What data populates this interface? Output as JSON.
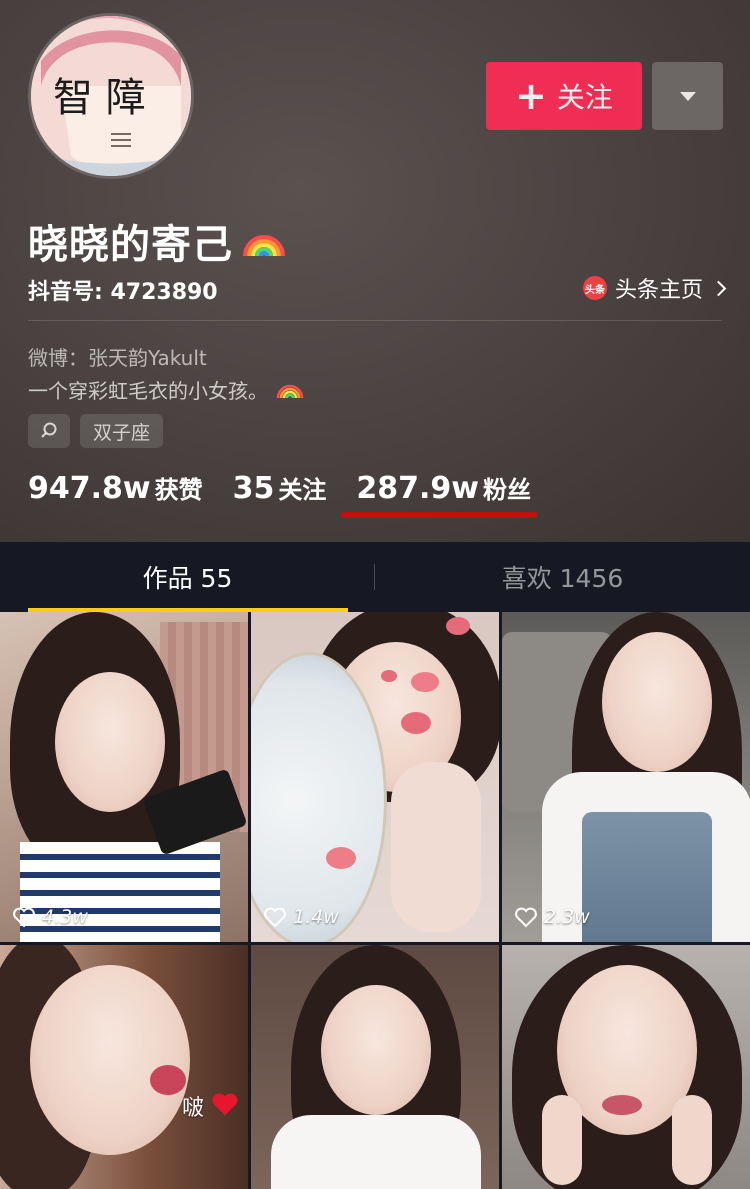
{
  "profile": {
    "avatar_text": "智 障",
    "nickname": "晓晓的寄己",
    "douyin_id": "抖音号: 4723890",
    "toutiao_badge": "头条",
    "toutiao_label": "头条主页",
    "weibo": "微博：张天韵Yakult",
    "signature": "一个穿彩虹毛衣的小女孩。",
    "tags": [
      "双子座"
    ]
  },
  "actions": {
    "follow_label": "关注",
    "follow_plus": "+"
  },
  "stats": {
    "likes_count": "947.8w",
    "likes_label": "获赞",
    "following_count": "35",
    "following_label": "关注",
    "fans_count": "287.9w",
    "fans_label": "粉丝"
  },
  "tabs": {
    "works": "作品 55",
    "likes": "喜欢 1456"
  },
  "videos": [
    {
      "likes": "4.3w"
    },
    {
      "likes": "1.4w"
    },
    {
      "likes": "2.3w"
    },
    {
      "overlay_text": "啵"
    },
    {},
    {}
  ],
  "colors": {
    "follow_button": "#fe2c55",
    "tab_indicator": "#facf0d",
    "fans_underline": "#c20f0f",
    "background": "#161823"
  }
}
